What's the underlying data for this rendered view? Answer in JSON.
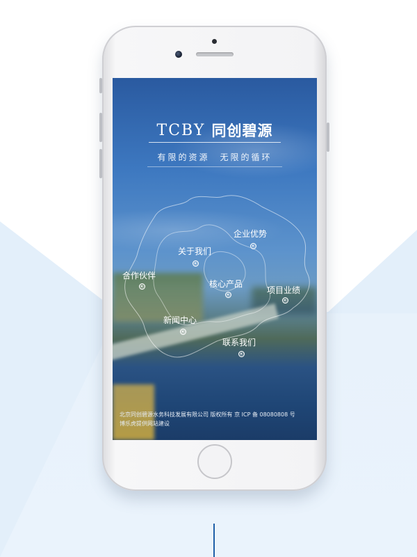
{
  "brand": {
    "logo_mark": "TCBY",
    "logo_name": "同创碧源",
    "slogan": "有限的资源　无限的循环"
  },
  "nav": {
    "items": [
      {
        "label": "企业优势"
      },
      {
        "label": "关于我们"
      },
      {
        "label": "合作伙伴"
      },
      {
        "label": "核心产品"
      },
      {
        "label": "项目业绩"
      },
      {
        "label": "新闻中心"
      },
      {
        "label": "联系我们"
      }
    ]
  },
  "footer": {
    "line1": "北京同创碧源水务科技发展有限公司  版权所有  京 ICP 备 08080808 号",
    "line2": "博乐虎提供网站建设"
  },
  "colors": {
    "accent": "#1f5fa8",
    "background_panel": "#e6f1fb"
  }
}
